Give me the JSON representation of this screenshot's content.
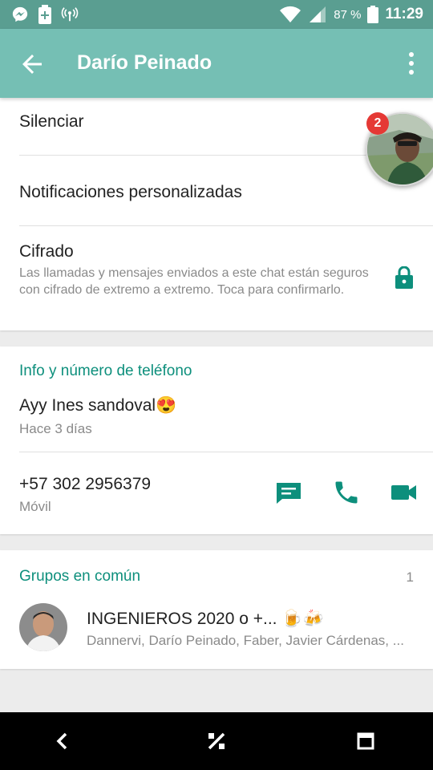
{
  "status_bar": {
    "icons_left": [
      "messenger-icon",
      "battery-saver-icon",
      "hotspot-icon"
    ],
    "icons_right": [
      "wifi-icon",
      "signal-icon",
      "battery-icon"
    ],
    "battery": "87 %",
    "time": "11:29"
  },
  "app_bar": {
    "title": "Darío Peinado",
    "back_icon": "arrow-left-icon",
    "menu_icon": "more-vert-icon",
    "notification_badge": "2"
  },
  "settings": {
    "mute": "Silenciar",
    "custom_notifications": "Notificaciones personalizadas",
    "encryption_title": "Cifrado",
    "encryption_desc": "Las llamadas y mensajes enviados a este chat están seguros con cifrado de extremo a extremo. Toca para confirmarlo."
  },
  "info": {
    "section_title": "Info y número de teléfono",
    "status": "Ayy Ines sandoval😍",
    "status_time": "Hace 3 días",
    "phone": "+57 302 2956379",
    "phone_type": "Móvil"
  },
  "groups": {
    "section_title": "Grupos en común",
    "count": "1",
    "items": [
      {
        "name": "INGENIEROS 2020 o +... 🍺🍻",
        "members": "Dannervi, Darío Peinado, Faber, Javier Cárdenas, ..."
      }
    ]
  },
  "colors": {
    "status_bar": "#5a9e91",
    "app_bar": "#75bfb4",
    "accent": "#0d8f7c",
    "badge": "#e53935"
  }
}
